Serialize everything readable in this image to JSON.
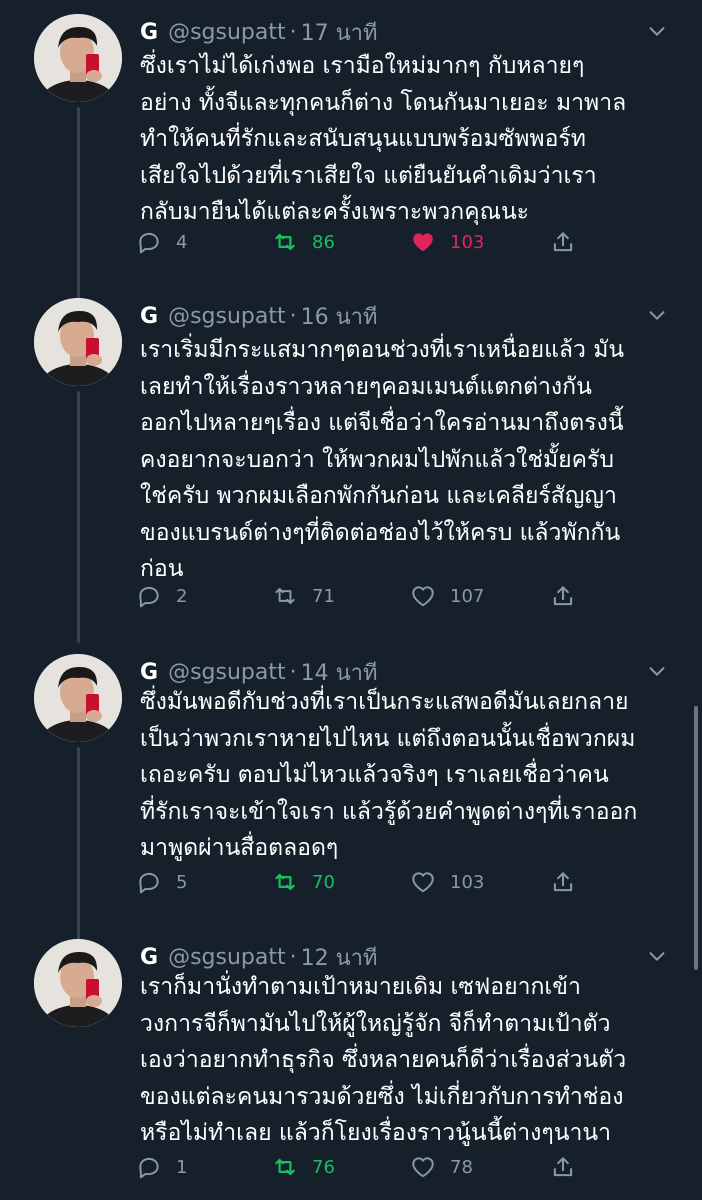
{
  "colors": {
    "background": "#15202b",
    "text": "#ffffff",
    "muted": "#8b98a5",
    "retweet_active": "#17bf63",
    "like_active": "#e0245e",
    "thread_line": "#38444d"
  },
  "tweets": [
    {
      "name": "G",
      "handle": "@sgsupatt",
      "separator": "·",
      "time": "17 นาที",
      "lines": [
        "ซึ่งเราไม่ได้เก่งพอ เรามือใหม่มากๆ กับหลายๆ",
        "อย่าง ทั้งจีและทุกคนก็ต่าง โดนกันมาเยอะ มาพาล",
        "ทำให้คนที่รักและสนับสนุนแบบพร้อมซัพพอร์ท",
        "เสียใจไปด้วยที่เราเสียใจ แต่ยืนยันคำเดิมว่าเรา",
        "กลับมายืนได้แต่ละครั้งเพราะพวกคุณนะ"
      ],
      "replies": "4",
      "retweets": "86",
      "likes": "103",
      "retweeted": true,
      "liked": true
    },
    {
      "name": "G",
      "handle": "@sgsupatt",
      "separator": "·",
      "time": "16 นาที",
      "lines": [
        "เราเริ่มมีกระแสมากๆตอนช่วงที่เราเหนื่อยแล้ว มัน",
        "เลยทำให้เรื่องราวหลายๆคอมเมนต์แตกต่างกัน",
        "ออกไปหลายๆเรื่อง แต่จีเชื่อว่าใครอ่านมาถึงตรงนี้",
        "คงอยากจะบอกว่า ให้พวกผมไปพักแล้วใช่มั้ยครับ",
        "ใช่ครับ พวกผมเลือกพักกันก่อน และเคลียร์สัญญา",
        "ของแบรนด์ต่างๆที่ติดต่อช่องไว้ให้ครบ แล้วพักกัน",
        "ก่อน"
      ],
      "replies": "2",
      "retweets": "71",
      "likes": "107",
      "retweeted": false,
      "liked": false
    },
    {
      "name": "G",
      "handle": "@sgsupatt",
      "separator": "·",
      "time": "14 นาที",
      "lines": [
        "ซึ่งมันพอดีกับช่วงที่เราเป็นกระแสพอดีมันเลยกลาย",
        "เป็นว่าพวกเราหายไปไหน แต่ถึงตอนนั้นเชื่อพวกผม",
        "เถอะครับ ตอบไม่ไหวแล้วจริงๆ เราเลยเชื่อว่าคน",
        "ที่รักเราจะเข้าใจเรา แล้วรู้ด้วยคำพูดต่างๆที่เราออก",
        "มาพูดผ่านสื่อตลอดๆ"
      ],
      "replies": "5",
      "retweets": "70",
      "likes": "103",
      "retweeted": true,
      "liked": false
    },
    {
      "name": "G",
      "handle": "@sgsupatt",
      "separator": "·",
      "time": "12 นาที",
      "lines": [
        "เราก็มานั่งทำตามเป้าหมายเดิม เซฟอยากเข้า",
        "วงการจีก็พามันไปให้ผู้ใหญ่รู้จัก จีก็ทำตามเป้าตัว",
        "เองว่าอยากทำธุรกิจ ซึ่งหลายคนก็ดีว่าเรื่องส่วนตัว",
        "ของแต่ละคนมารวมด้วยซึ่ง ไม่เกี่ยวกับการทำช่อง",
        "หรือไม่ทำเลย แล้วก็โยงเรื่องราวนู้นนี้ต่างๆนานา"
      ],
      "replies": "1",
      "retweets": "76",
      "likes": "78",
      "retweeted": true,
      "liked": false
    }
  ],
  "icons": {
    "reply": "reply-icon",
    "retweet": "retweet-icon",
    "like": "heart-icon",
    "share": "share-icon",
    "more": "more-icon"
  }
}
